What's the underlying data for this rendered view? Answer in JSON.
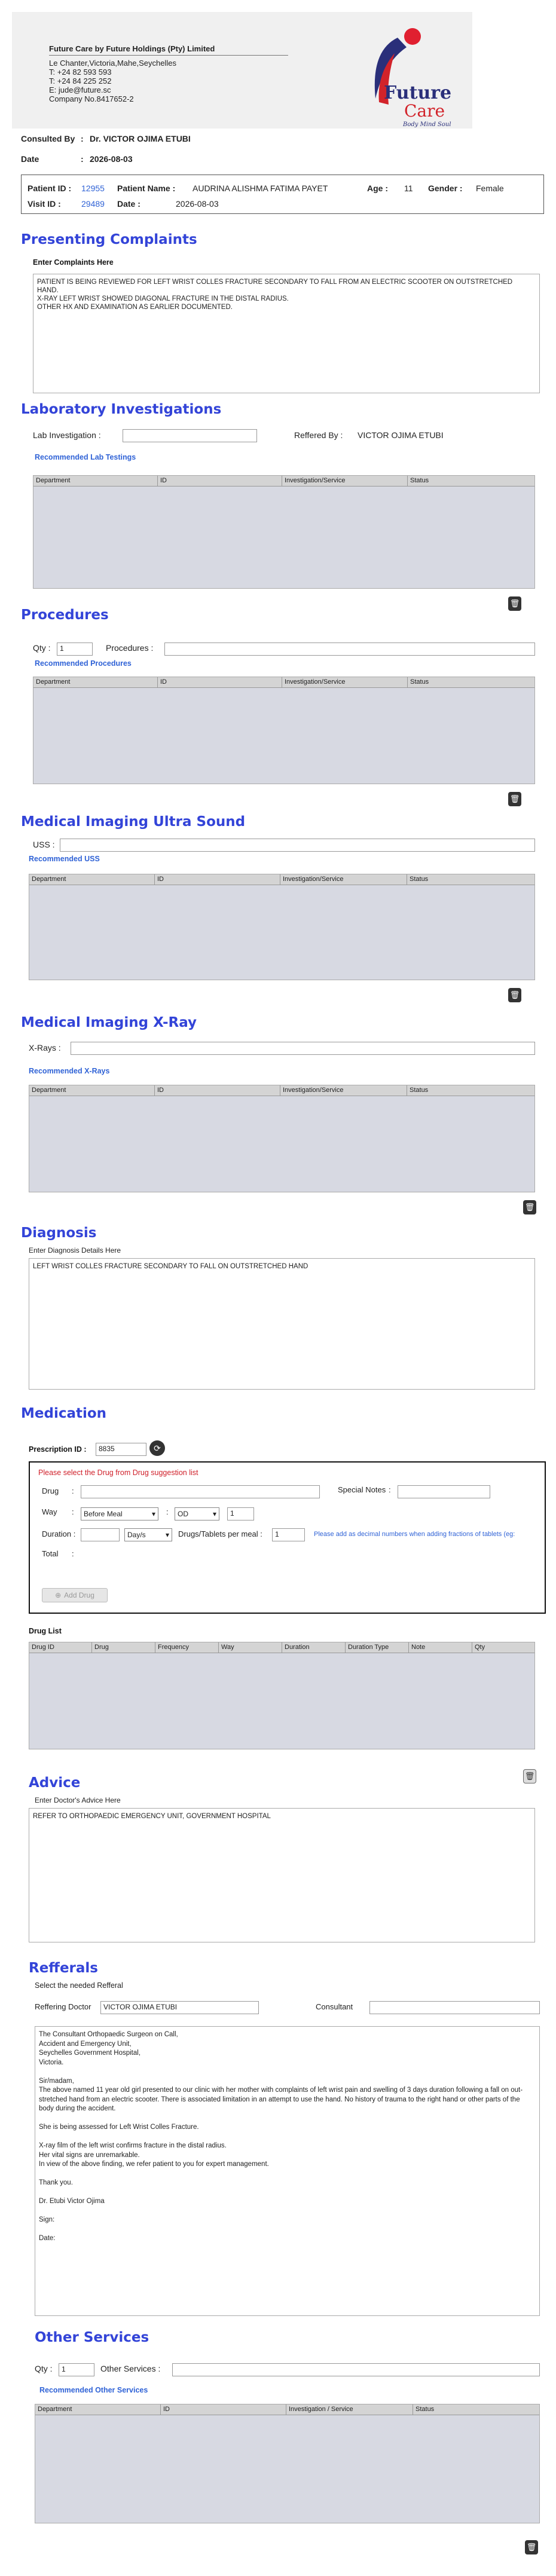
{
  "company": {
    "name_line": "Future Care by Future Holdings (Pty) Limited",
    "address1": "Le Chanter,Victoria,Mahe,Seychelles",
    "phone1": "T: +24  82 593 593",
    "phone2": "T: +24  84 225 252",
    "email": "E: jude@future.sc",
    "company_no": "Company No.8417652-2",
    "logo_word1": "Future",
    "logo_word2": "Care",
    "logo_tagline": "Body Mind Soul"
  },
  "consult": {
    "consulted_label": "Consulted By",
    "consulted_value": "Dr.   VICTOR OJIMA ETUBI",
    "date_label": "Date",
    "date_value": "2026-08-03"
  },
  "patient": {
    "id_label": "Patient ID",
    "id_value": "12955",
    "name_label": "Patient Name",
    "name_value": "AUDRINA ALISHMA FATIMA PAYET",
    "age_label": "Age",
    "age_value": "11",
    "gender_label": "Gender",
    "gender_value": "Female",
    "visit_label": "Visit ID",
    "visit_value": "29489",
    "date_label": "Date",
    "date_value": "2026-08-03"
  },
  "complaints": {
    "title": "Presenting Complaints",
    "subtitle": "Enter Complaints Here",
    "text": "PATIENT IS BEING REVIEWED FOR LEFT WRIST COLLES FRACTURE SECONDARY TO FALL FROM AN ELECTRIC SCOOTER ON OUTSTRETCHED HAND.\nX-RAY LEFT WRIST SHOWED DIAGONAL FRACTURE IN THE DISTAL RADIUS.\nOTHER HX AND EXAMINATION AS EARLIER DOCUMENTED."
  },
  "lab": {
    "title": "Laboratory  Investigations",
    "input_label": "Lab Investigation :",
    "referred_label": "Reffered By :",
    "referred_value": "VICTOR OJIMA ETUBI",
    "recommended": "Recommended Lab Testings",
    "cols": [
      "Department",
      "ID",
      "Investigation/Service",
      "Status"
    ]
  },
  "procedures": {
    "title": "Procedures",
    "qty_label": "Qty :",
    "qty_value": "1",
    "proc_label": "Procedures :",
    "recommended": "Recommended Procedures",
    "cols": [
      "Department",
      "ID",
      "Investigation/Service",
      "Status"
    ]
  },
  "uss": {
    "title": "Medical Imaging Ultra Sound",
    "label": "USS :",
    "recommended": "Recommended USS",
    "cols": [
      "Department",
      "ID",
      "Investigation/Service",
      "Status"
    ]
  },
  "xray": {
    "title": "Medical Imaging X-Ray",
    "label": "X-Rays :",
    "recommended": "Recommended X-Rays",
    "cols": [
      "Department",
      "ID",
      "Investigation/Service",
      "Status"
    ]
  },
  "diagnosis": {
    "title": "Diagnosis",
    "subtitle": "Enter Diagnosis Details Here",
    "text": "LEFT WRIST COLLES FRACTURE SECONDARY TO FALL ON OUTSTRETCHED HAND"
  },
  "medication": {
    "title": "Medication",
    "prescription_label": "Prescription ID :",
    "prescription_value": "8835",
    "warning": "Please select the Drug from Drug suggestion list",
    "drug_label": "Drug",
    "special_label": "Special Notes",
    "way_label": "Way",
    "way_value": "Before Meal",
    "freq_value": "OD",
    "freq_qty": "1",
    "duration_label": "Duration :",
    "duration_unit": "Day/s",
    "per_meal_label": "Drugs/Tablets per meal :",
    "per_meal_value": "1",
    "decimal_note": "Please add as decimal numbers when adding fractions of tablets (eg:",
    "total_label": "Total",
    "add_button": "Add Drug",
    "druglist_title": "Drug List",
    "druglist_cols": [
      "Drug ID",
      "Drug",
      "Frequency",
      "Way",
      "Duration",
      "Duration Type",
      "Note",
      "Qty"
    ]
  },
  "advice": {
    "title": "Advice",
    "subtitle": "Enter Doctor's Advice Here",
    "text": "REFER TO ORTHOPAEDIC EMERGENCY UNIT, GOVERNMENT HOSPITAL"
  },
  "referrals": {
    "title": "Refferals",
    "subtitle": "Select the needed Refferal",
    "doctor_label": "Reffering Doctor",
    "doctor_value": "VICTOR OJIMA ETUBI",
    "consultant_label": "Consultant",
    "letter": "The Consultant Orthopaedic Surgeon on Call,\nAccident and Emergency Unit,\nSeychelles Government Hospital,\nVictoria.\n\nSir/madam,\nThe above named 11 year old girl presented to our clinic with her mother with complaints of left wrist pain and swelling of 3 days duration following a fall on out-stretched hand from an electric scooter. There is associated limitation in an attempt to use the hand. No history of trauma to the right hand or other parts of the body during the accident.\n\nShe is being assessed for Left Wrist Colles Fracture.\n\nX-ray film of the left wrist confirms fracture in the distal radius.\nHer vital signs are unremarkable.\nIn view of the above finding, we refer patient to you for expert management.\n\nThank you.\n\nDr. Etubi Victor Ojima\n\nSign:\n\nDate:"
  },
  "other": {
    "title": "Other Services",
    "qty_label": "Qty :",
    "qty_value": "1",
    "services_label": "Other Services :",
    "recommended": "Recommended Other Services",
    "cols": [
      "Department",
      "ID",
      "Investigation / Service",
      "Status"
    ]
  }
}
